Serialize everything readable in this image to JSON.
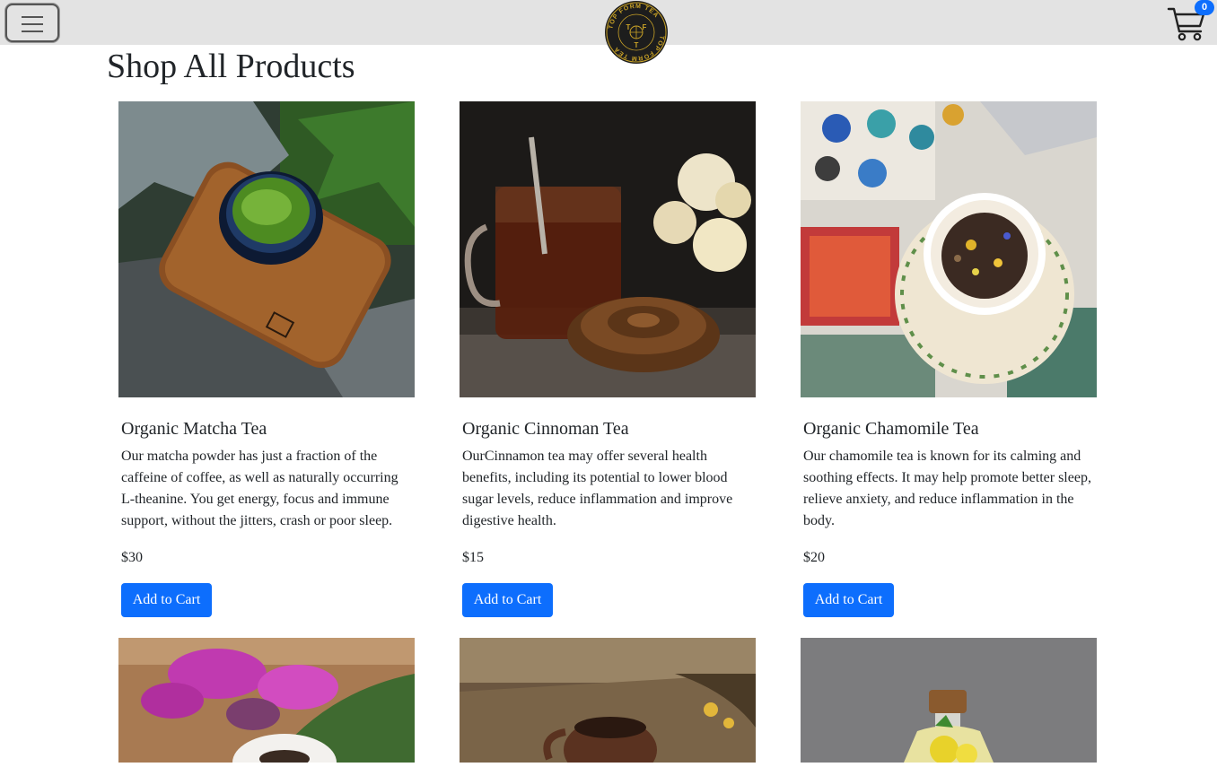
{
  "navbar": {
    "menu_icon": "hamburger-icon",
    "logo_text": "TOP FORM TEA",
    "logo_letters": [
      "T",
      "F",
      "T"
    ],
    "cart_icon": "shopping-cart-icon",
    "cart_count": "0"
  },
  "page": {
    "title": "Shop All Products"
  },
  "colors": {
    "navbar_bg": "#e3e3e3",
    "primary": "#0d6efd",
    "text": "#212529"
  },
  "products": [
    {
      "name": "Organic Matcha Tea",
      "description": "Our matcha powder has just a fraction of the caffeine of coffee, as well as naturally occurring L-theanine. You get energy, focus and immune support, without the jitters, crash or poor sleep.",
      "price": "$30",
      "button": "Add to Cart"
    },
    {
      "name": "Organic Cinnoman Tea",
      "description": "OurCinnamon tea may offer several health benefits, including its potential to lower blood sugar levels, reduce inflammation and improve digestive health.",
      "price": "$15",
      "button": "Add to Cart"
    },
    {
      "name": "Organic Chamomile Tea",
      "description": "Our chamomile tea is known for its calming and soothing effects. It may help promote better sleep, relieve anxiety, and reduce inflammation in the body.",
      "price": "$20",
      "button": "Add to Cart"
    }
  ]
}
